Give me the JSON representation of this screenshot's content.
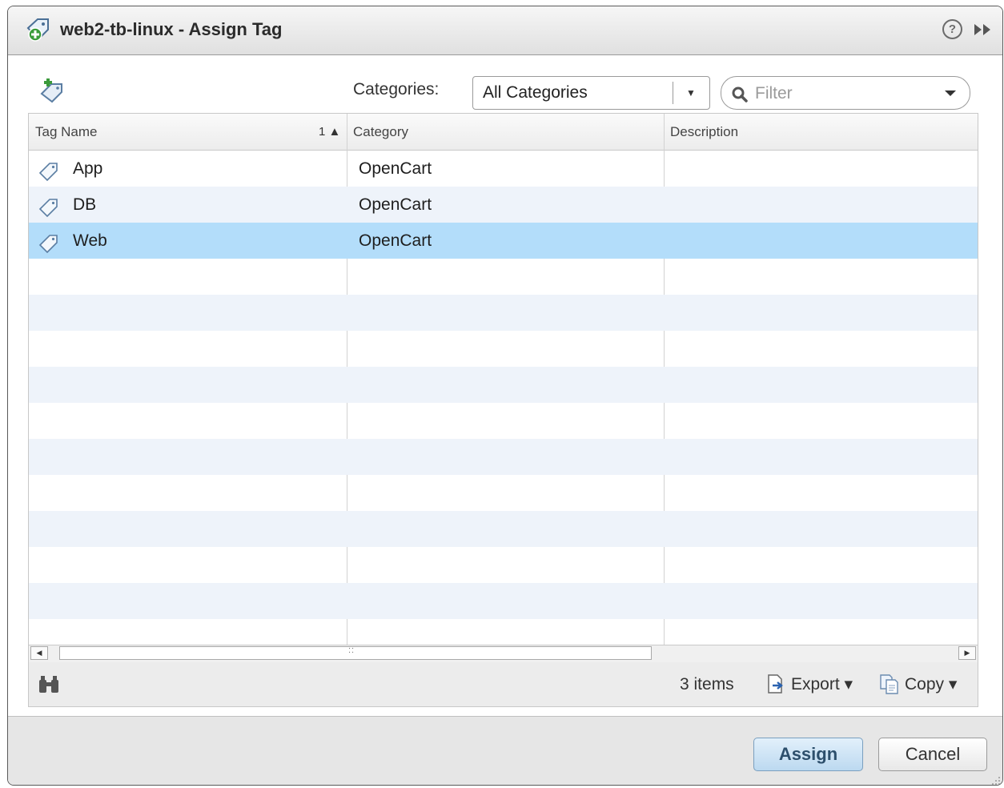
{
  "dialog": {
    "title": "web2-tb-linux - Assign Tag",
    "title_icon": "vm-tag-icon",
    "help_icon": "help-icon",
    "expand_icon": "forward-icon"
  },
  "toolbar": {
    "add_tag_icon": "add-tag-icon",
    "categories_label": "Categories:",
    "categories_selected": "All Categories",
    "filter_placeholder": "Filter"
  },
  "grid": {
    "columns": [
      {
        "label": "Tag Name",
        "sort": "1 ▲"
      },
      {
        "label": "Category",
        "sort": ""
      },
      {
        "label": "Description",
        "sort": ""
      }
    ],
    "rows": [
      {
        "tag": "App",
        "category": "OpenCart",
        "description": "",
        "selected": false
      },
      {
        "tag": "DB",
        "category": "OpenCart",
        "description": "",
        "selected": false
      },
      {
        "tag": "Web",
        "category": "OpenCart",
        "description": "",
        "selected": true
      }
    ],
    "footer": {
      "items_count": "3 items",
      "export_label": "Export",
      "copy_label": "Copy"
    }
  },
  "buttons": {
    "assign": "Assign",
    "cancel": "Cancel"
  },
  "colors": {
    "selected_row": "#b3ddfa",
    "alt_row": "#eef3fa",
    "assign_text": "#2d4f6c"
  }
}
